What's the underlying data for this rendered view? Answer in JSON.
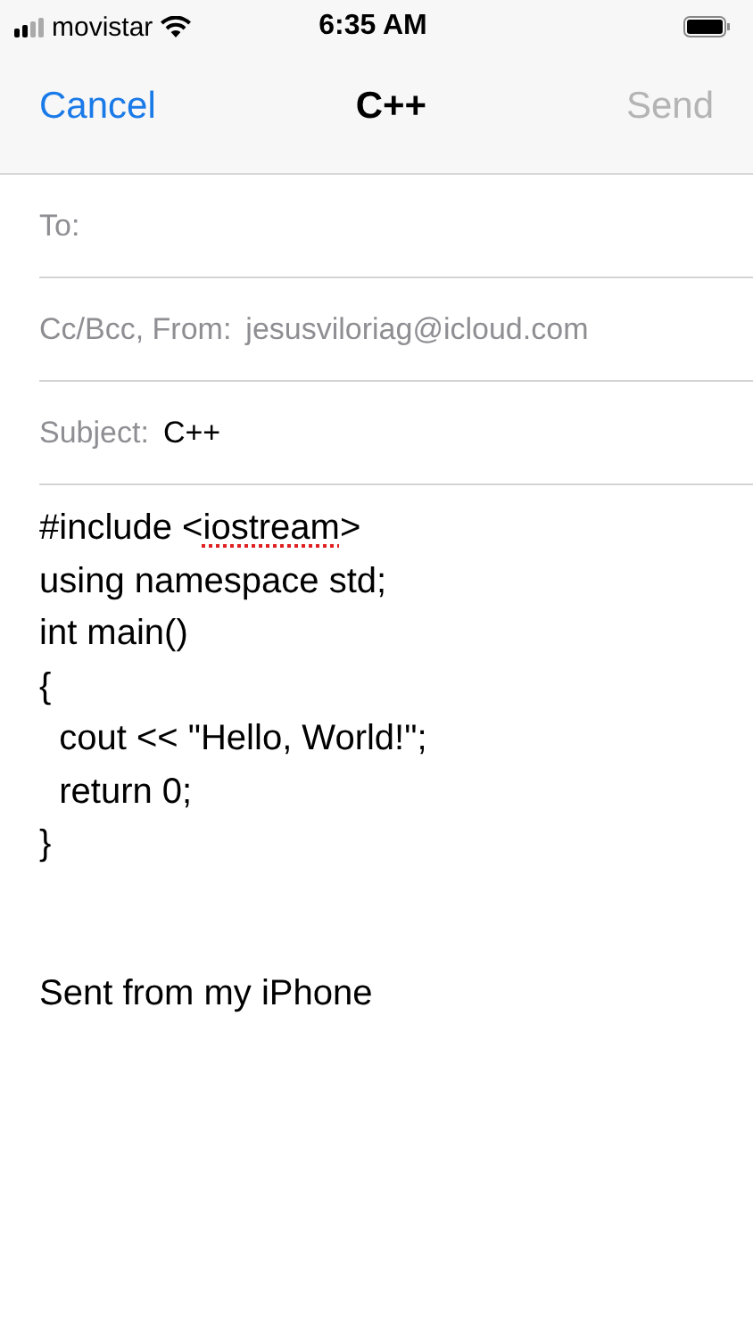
{
  "status_bar": {
    "carrier": "movistar",
    "time": "6:35 AM"
  },
  "nav_bar": {
    "cancel": "Cancel",
    "title": "C++",
    "send": {
      "label": "Send",
      "disabled": true
    }
  },
  "fields": [
    {
      "label": "To:"
    },
    {
      "label": "Cc/Bcc, From:",
      "value": "jesusviloriag@icloud.com",
      "kind": "muted"
    },
    {
      "label": "Subject:",
      "value": "C++",
      "kind": "normal"
    }
  ],
  "body": {
    "lines": [
      {
        "parts": [
          {
            "text": "#include <",
            "misspelled": false
          },
          {
            "text": "iostream",
            "misspelled": true
          },
          {
            "text": ">",
            "misspelled": false
          }
        ]
      },
      {
        "parts": [
          {
            "text": "using namespace std;",
            "misspelled": false
          }
        ]
      },
      {
        "parts": [
          {
            "text": "int main()",
            "misspelled": false
          }
        ]
      },
      {
        "parts": [
          {
            "text": "{",
            "misspelled": false
          }
        ]
      },
      {
        "parts": [
          {
            "text": "  cout << \"Hello, World!\";",
            "misspelled": false
          }
        ]
      },
      {
        "parts": [
          {
            "text": "  return 0;",
            "misspelled": false
          }
        ]
      },
      {
        "parts": [
          {
            "text": "}",
            "misspelled": false
          }
        ]
      }
    ],
    "signature": "Sent from my iPhone"
  }
}
